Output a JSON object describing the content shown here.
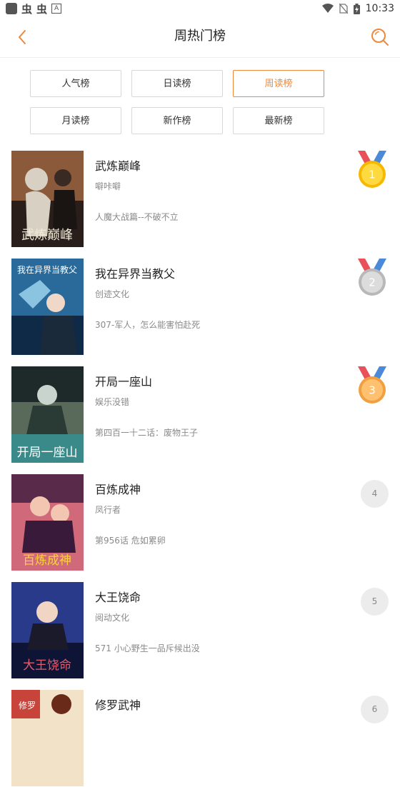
{
  "status_bar": {
    "time": "10:33",
    "icons": [
      "notification-square-icon",
      "bug-icon",
      "bug-icon",
      "a-icon",
      "wifi-icon",
      "no-sim-icon",
      "battery-icon"
    ]
  },
  "header": {
    "title": "周热门榜",
    "back_icon": "chevron-left-icon",
    "search_icon": "search-icon",
    "accent_color": "#f0883a"
  },
  "tabs": [
    {
      "label": "人气榜",
      "active": false
    },
    {
      "label": "日读榜",
      "active": false
    },
    {
      "label": "周读榜",
      "active": true
    },
    {
      "label": "月读榜",
      "active": false
    },
    {
      "label": "新作榜",
      "active": false
    },
    {
      "label": "最新榜",
      "active": false
    }
  ],
  "items": [
    {
      "rank": "1",
      "title": "武炼巅峰",
      "author": "噼咔噼",
      "chapter": "人魔大战篇--不破不立",
      "badge": "gold-medal-icon",
      "cover_colors": [
        "#8a5a3a",
        "#2a1e1a",
        "#d9d0c4"
      ]
    },
    {
      "rank": "2",
      "title": "我在异界当教父",
      "author": "创迹文化",
      "chapter": "307-军人，怎么能害怕赴死",
      "badge": "silver-medal-icon",
      "cover_colors": [
        "#2a6a9a",
        "#0e2a46",
        "#8ac4e0"
      ]
    },
    {
      "rank": "3",
      "title": "开局一座山",
      "author": "娱乐没错",
      "chapter": "第四百一十二话：废物王子",
      "badge": "bronze-medal-icon",
      "cover_colors": [
        "#5a6a5a",
        "#1e2a2a",
        "#c9d4cf"
      ]
    },
    {
      "rank": "4",
      "title": "百炼成神",
      "author": "凤行者",
      "chapter": "第956话 危如累卵",
      "badge": "rank-circle",
      "cover_colors": [
        "#d06a7a",
        "#5a2a4a",
        "#f2c6b0"
      ]
    },
    {
      "rank": "5",
      "title": "大王饶命",
      "author": "阅动文化",
      "chapter": "571 小心野生一品斥候出没",
      "badge": "rank-circle",
      "cover_colors": [
        "#2a3a8a",
        "#0e1436",
        "#e85a6a"
      ]
    },
    {
      "rank": "6",
      "title": "修罗武神",
      "author": "",
      "chapter": "",
      "badge": "rank-circle",
      "cover_colors": [
        "#c8443a",
        "#f2e2c8",
        "#6a2a1a"
      ]
    }
  ]
}
